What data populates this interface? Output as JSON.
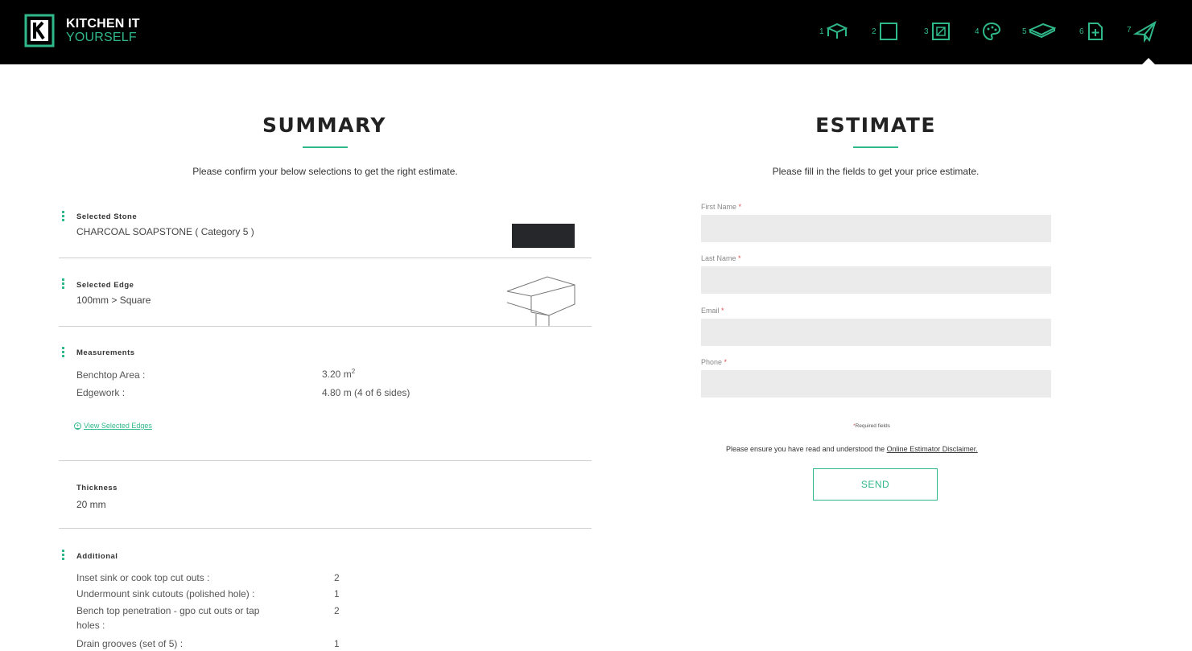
{
  "brand": {
    "line1": "KITCHEN IT",
    "line2": "YOURSELF"
  },
  "steps": [
    {
      "num": "1",
      "icon": "bench-icon"
    },
    {
      "num": "2",
      "icon": "square-icon"
    },
    {
      "num": "3",
      "icon": "framed-square-icon"
    },
    {
      "num": "4",
      "icon": "palette-icon"
    },
    {
      "num": "5",
      "icon": "slab-icon"
    },
    {
      "num": "6",
      "icon": "add-document-icon"
    },
    {
      "num": "7",
      "icon": "send-plane-icon"
    }
  ],
  "colors": {
    "accent": "#2fb889",
    "header": "#000000",
    "required": "#e05050"
  },
  "summary": {
    "title": "SUMMARY",
    "subtitle": "Please confirm your below selections to get the right estimate.",
    "stone": {
      "label": "Selected Stone",
      "value": "CHARCOAL SOAPSTONE ( Category 5 )"
    },
    "edge": {
      "label": "Selected Edge",
      "value": "100mm > Square"
    },
    "measurements": {
      "label": "Measurements",
      "benchtop_label": "Benchtop Area :",
      "benchtop_value": "3.20 m",
      "benchtop_unit_sup": "2",
      "edgework_label": "Edgework :",
      "edgework_value": "4.80 m (4 of 6 sides)",
      "view_edges_link": "View Selected Edges"
    },
    "thickness": {
      "label": "Thickness",
      "value": "20 mm"
    },
    "additional": {
      "label": "Additional",
      "rows": [
        {
          "label": "Inset sink or cook top cut outs :",
          "value": "2"
        },
        {
          "label": "Undermount sink cutouts (polished hole) :",
          "value": "1"
        },
        {
          "label": "Bench top penetration - gpo cut outs or tap",
          "label2": "holes :",
          "value": "2"
        },
        {
          "label": "Drain grooves (set of 5) :",
          "value": "1"
        }
      ]
    }
  },
  "estimate": {
    "title": "ESTIMATE",
    "subtitle": "Please fill in the fields to get your price estimate.",
    "fields": {
      "first_name": {
        "label": "First Name",
        "value": ""
      },
      "last_name": {
        "label": "Last Name",
        "value": ""
      },
      "email": {
        "label": "Email",
        "value": ""
      },
      "phone": {
        "label": "Phone",
        "value": ""
      }
    },
    "required_marker": "*",
    "required_note": "Required fields",
    "disclaimer_text": "Please ensure you have read and understood the",
    "disclaimer_link": "Online Estimator Disclaimer.",
    "send_label": "SEND"
  }
}
